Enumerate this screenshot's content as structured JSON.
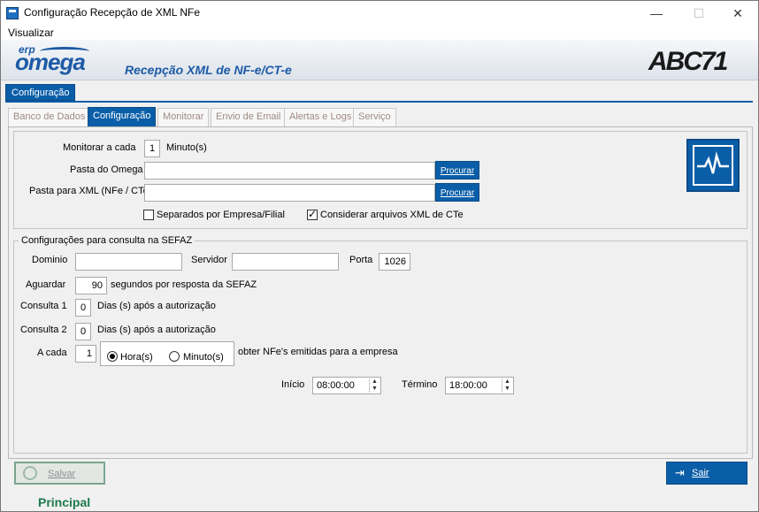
{
  "window": {
    "title": "Configuração Recepção de XML NFe",
    "minimize": "—",
    "maximize": "☐",
    "close": "✕"
  },
  "menu": {
    "visualizar": "Visualizar"
  },
  "banner": {
    "logo_small": "erp",
    "logo_main": "omega",
    "title": "Recepção XML de NF-e/CT-e",
    "brand": "ABC71"
  },
  "top_tab": "Configuração",
  "tabs": [
    "Banco de Dados",
    "Configuração",
    "Monitorar",
    "Envio de Email",
    "Alertas e Logs",
    "Serviço"
  ],
  "config": {
    "monitorar_label": "Monitorar a cada",
    "monitorar_value": "1",
    "monitorar_unit": "Minuto(s)",
    "pasta_omega_label": "Pasta do Omega",
    "pasta_omega_value": "",
    "pasta_xml_label": "Pasta para XML (NFe / CTe)",
    "pasta_xml_value": "",
    "procurar": "Procurar",
    "separados_label": "Separados por Empresa/Filial",
    "separados_checked": false,
    "considerar_label": "Considerar arquivos XML de CTe",
    "considerar_checked": true
  },
  "sefaz": {
    "group_title": "Configurações para consulta na SEFAZ",
    "dominio_label": "Dominio",
    "dominio_value": "",
    "servidor_label": "Servidor",
    "servidor_value": "",
    "porta_label": "Porta",
    "porta_value": "1026",
    "aguardar_label": "Aguardar",
    "aguardar_value": "90",
    "aguardar_suffix": "segundos por resposta da SEFAZ",
    "consulta1_label": "Consulta 1",
    "consulta1_value": "0",
    "consulta2_label": "Consulta 2",
    "consulta2_value": "0",
    "dias_suffix": "Dias (s) após a autorização",
    "acada_label": "A cada",
    "acada_value": "1",
    "hora_label": "Hora(s)",
    "minuto_label": "Minuto(s)",
    "obter_label": "obter NFe's emitidas para a empresa",
    "inicio_label": "Início",
    "inicio_value": "08:00:00",
    "termino_label": "Término",
    "termino_value": "18:00:00"
  },
  "buttons": {
    "salvar": "Salvar",
    "sair": "Sair"
  },
  "status": "Principal",
  "colors": {
    "accent": "#0a5ea8",
    "status_green": "#1d7a4e",
    "inactive_tab_text": "#9e8a86"
  }
}
